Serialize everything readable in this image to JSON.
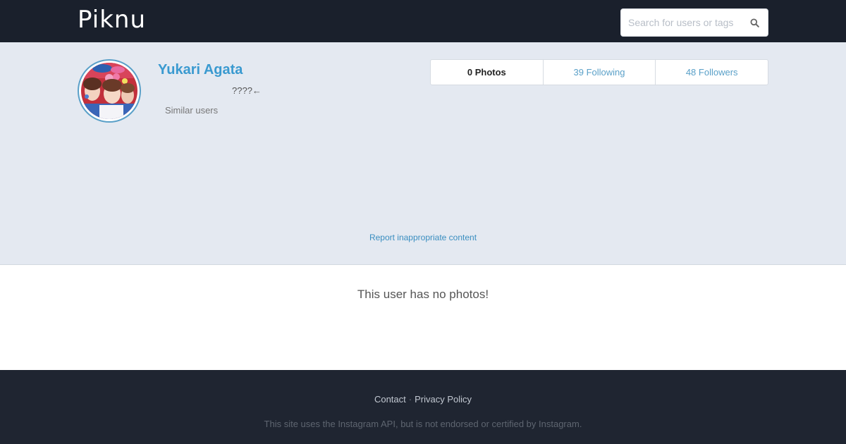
{
  "header": {
    "logo": "Piknu",
    "search": {
      "placeholder": "Search for users or tags",
      "icon": "search-icon"
    }
  },
  "profile": {
    "name": "Yukari Agata",
    "bio": "????←",
    "similar_users_label": "Similar users",
    "avatar_icon": "profile-photo"
  },
  "stats": {
    "photos": "0 Photos",
    "following": "39 Following",
    "followers": "48 Followers"
  },
  "report_label": "Report inappropriate content",
  "content": {
    "empty_message": "This user has no photos!"
  },
  "footer": {
    "contact": "Contact",
    "separator": "·",
    "privacy": "Privacy Policy",
    "note": "This site uses the Instagram API, but is not endorsed or certified by Instagram."
  },
  "colors": {
    "header_bg": "#1a202c",
    "profile_bg": "#e4e9f1",
    "accent": "#3a9ad0",
    "footer_bg": "#1f2531"
  }
}
